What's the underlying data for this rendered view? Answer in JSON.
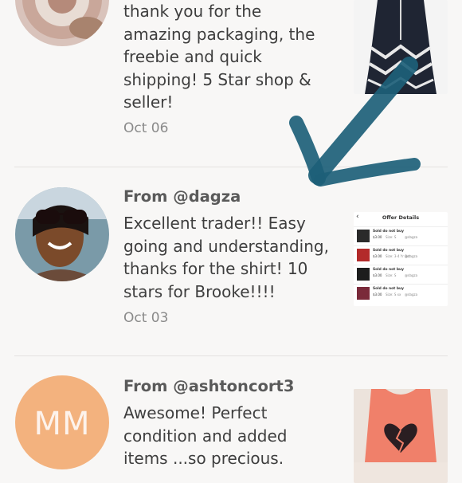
{
  "reviews": [
    {
      "from": "",
      "text": "thank you for the\namazing packaging, the\nfreebie and quick\nshipping! 5 Star shop &\nseller!",
      "date": "Oct 06"
    },
    {
      "from": "From @dagza",
      "text": "Excellent trader!! Easy\ngoing and understanding,\nthanks for the shirt! 10\nstars for Brooke!!!!",
      "date": "Oct 03",
      "offer_details": {
        "title": "Offer Details",
        "back": "‹",
        "rows": [
          {
            "title": "Sold do not buy",
            "price": "$3.00",
            "size": "Size: S",
            "user": "@dagza"
          },
          {
            "title": "Sold do not buy",
            "price": "$3.00",
            "size": "Size: 3-4 Yr Oct",
            "user": "@dagza"
          },
          {
            "title": "Sold do not buy",
            "price": "$3.00",
            "size": "Size: S",
            "user": "@dagza"
          },
          {
            "title": "Sold do not buy",
            "price": "$3.00",
            "size": "Size: S xx",
            "user": "@dagza"
          }
        ]
      }
    },
    {
      "from": "From @ashtoncort3",
      "initials": "MM",
      "text": "Awesome! Perfect\ncondition and added\nitems ...so precious.",
      "date": ""
    }
  ],
  "colors": {
    "background": "#f8f7f6",
    "avatar_mm": "#f3b27e",
    "arrow": "#1d5f78"
  }
}
